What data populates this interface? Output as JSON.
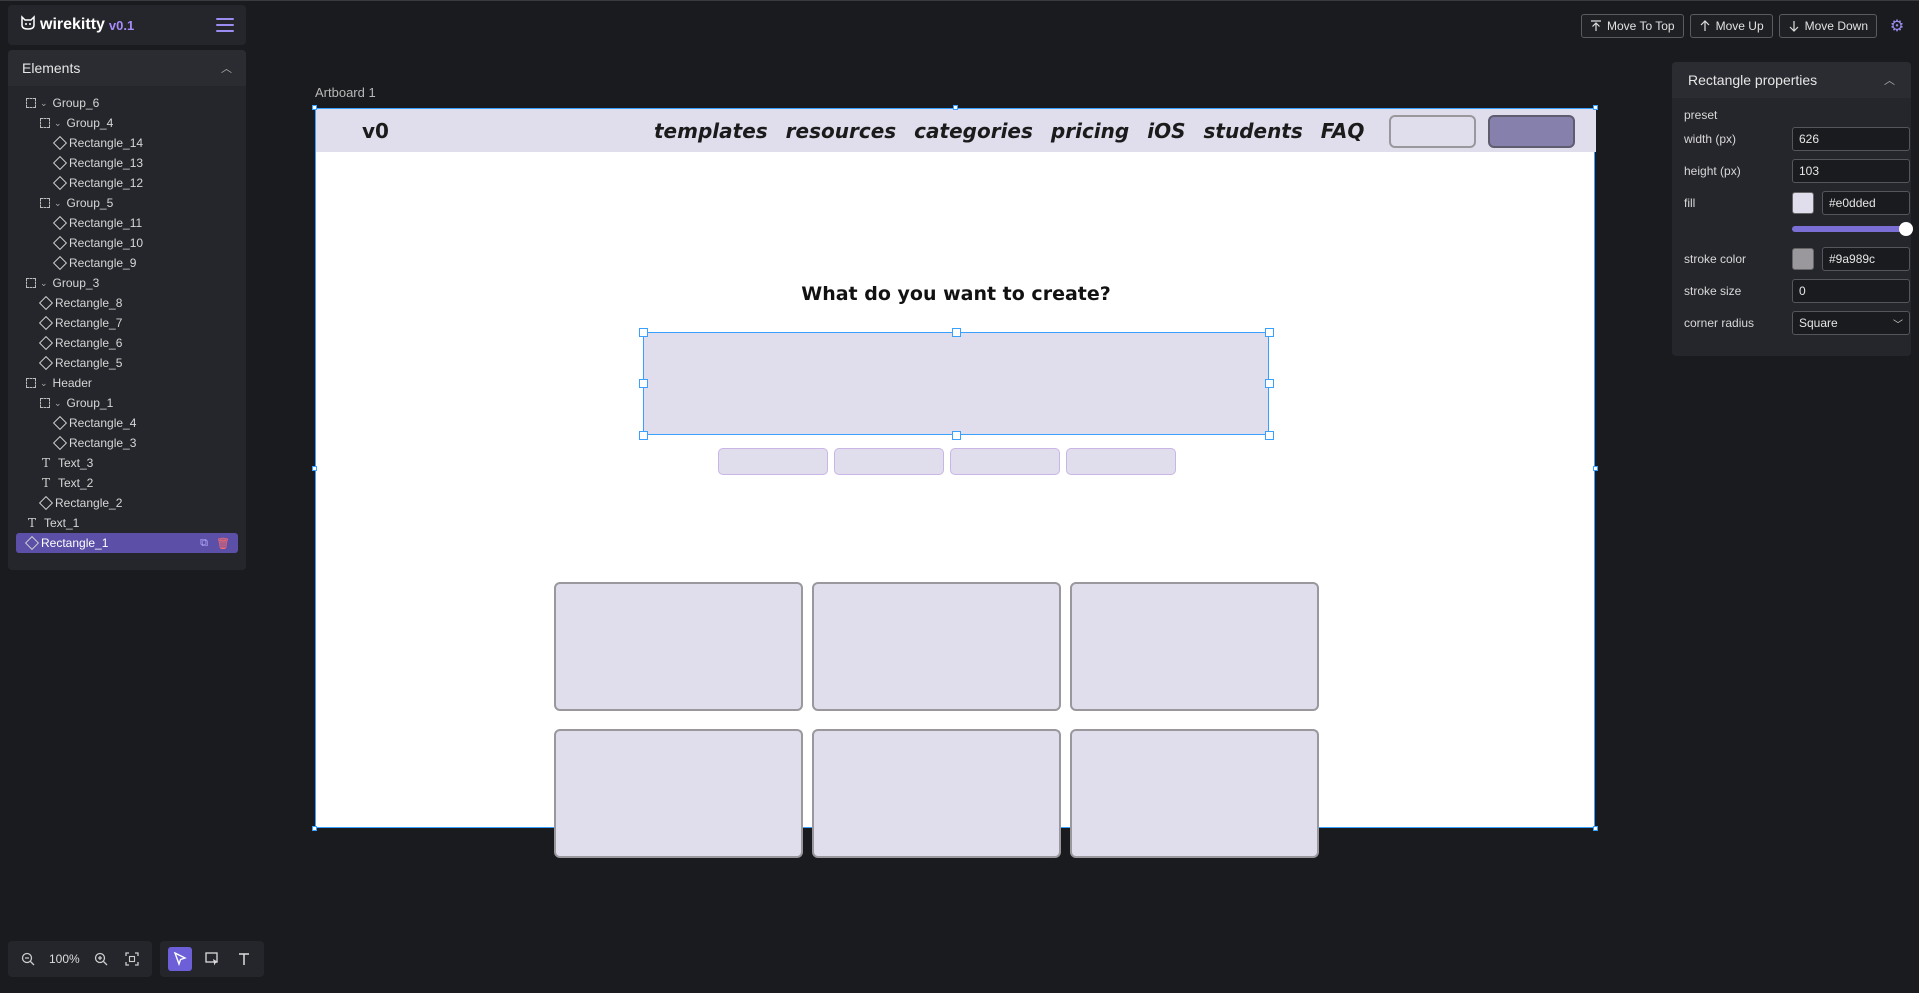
{
  "brand": {
    "name": "wirekitty",
    "version": "v0.1"
  },
  "elements_panel": {
    "title": "Elements",
    "items": [
      {
        "label": "Group_6",
        "type": "group",
        "depth": 0
      },
      {
        "label": "Group_4",
        "type": "group",
        "depth": 1
      },
      {
        "label": "Rectangle_14",
        "type": "rect",
        "depth": 2
      },
      {
        "label": "Rectangle_13",
        "type": "rect",
        "depth": 2
      },
      {
        "label": "Rectangle_12",
        "type": "rect",
        "depth": 2
      },
      {
        "label": "Group_5",
        "type": "group",
        "depth": 1
      },
      {
        "label": "Rectangle_11",
        "type": "rect",
        "depth": 2
      },
      {
        "label": "Rectangle_10",
        "type": "rect",
        "depth": 2
      },
      {
        "label": "Rectangle_9",
        "type": "rect",
        "depth": 2
      },
      {
        "label": "Group_3",
        "type": "group",
        "depth": 0
      },
      {
        "label": "Rectangle_8",
        "type": "rect",
        "depth": 1
      },
      {
        "label": "Rectangle_7",
        "type": "rect",
        "depth": 1
      },
      {
        "label": "Rectangle_6",
        "type": "rect",
        "depth": 1
      },
      {
        "label": "Rectangle_5",
        "type": "rect",
        "depth": 1
      },
      {
        "label": "Header",
        "type": "group",
        "depth": 0
      },
      {
        "label": "Group_1",
        "type": "group",
        "depth": 1
      },
      {
        "label": "Rectangle_4",
        "type": "rect",
        "depth": 2
      },
      {
        "label": "Rectangle_3",
        "type": "rect",
        "depth": 2
      },
      {
        "label": "Text_3",
        "type": "text",
        "depth": 1
      },
      {
        "label": "Text_2",
        "type": "text",
        "depth": 1
      },
      {
        "label": "Rectangle_2",
        "type": "rect",
        "depth": 1
      },
      {
        "label": "Text_1",
        "type": "text",
        "depth": 0
      },
      {
        "label": "Rectangle_1",
        "type": "rect",
        "depth": 0,
        "selected": true
      }
    ]
  },
  "toolbar": {
    "move_to_top": "Move To Top",
    "move_up": "Move Up",
    "move_down": "Move Down"
  },
  "properties": {
    "title": "Rectangle properties",
    "preset_label": "preset",
    "width_label": "width (px)",
    "width_value": "626",
    "height_label": "height (px)",
    "height_value": "103",
    "fill_label": "fill",
    "fill_value": "#e0dded",
    "fill_opacity": 1.0,
    "stroke_color_label": "stroke color",
    "stroke_color_value": "#9a989c",
    "stroke_size_label": "stroke size",
    "stroke_size_value": "0",
    "corner_radius_label": "corner radius",
    "corner_radius_value": "Square"
  },
  "canvas": {
    "artboard_label": "Artboard 1",
    "logo": "v0",
    "nav": [
      "templates",
      "resources",
      "categories",
      "pricing",
      "iOS",
      "students",
      "FAQ"
    ],
    "headline": "What do you want to create?"
  },
  "zoom": {
    "level": "100%"
  },
  "colors": {
    "accent": "#6c5fd8",
    "selection": "#3aa0ff",
    "wire_fill": "#e0dded",
    "wire_stroke": "#9a989c"
  }
}
